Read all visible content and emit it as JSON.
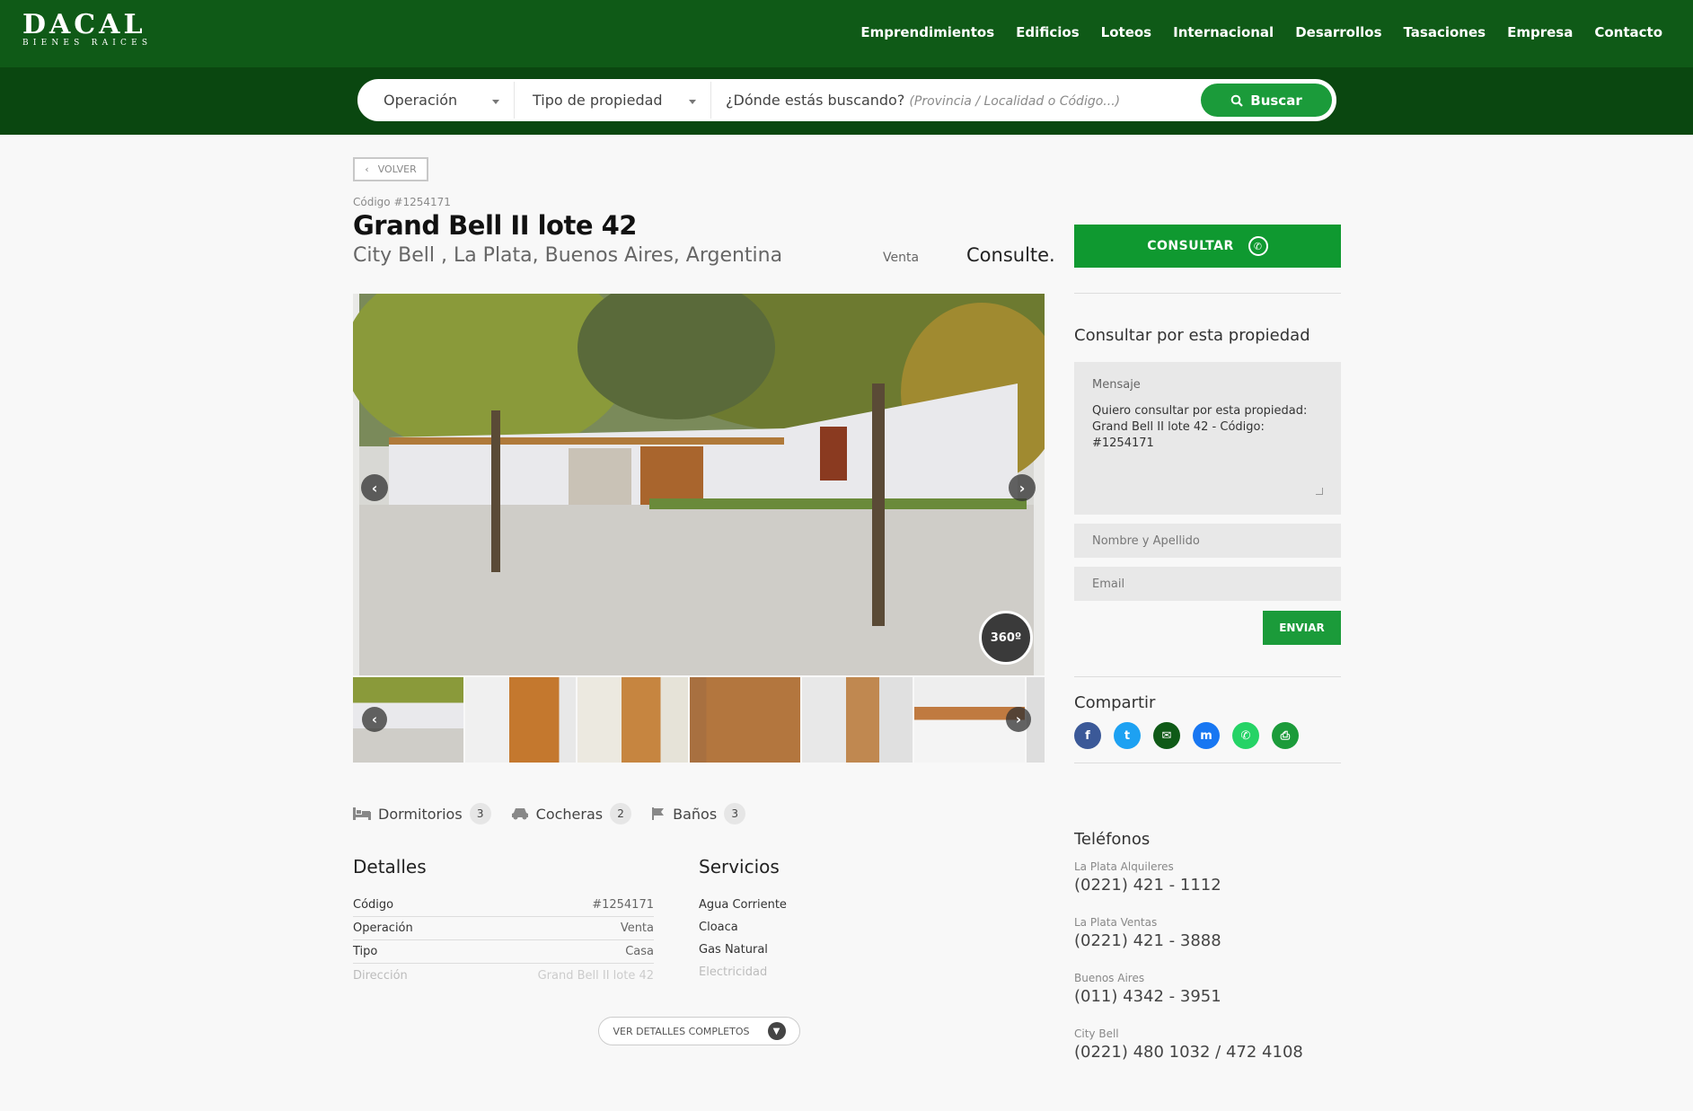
{
  "brand": {
    "name": "DACAL",
    "tagline": "BIENES RAICES"
  },
  "nav": [
    "Emprendimientos",
    "Edificios",
    "Loteos",
    "Internacional",
    "Desarrollos",
    "Tasaciones",
    "Empresa",
    "Contacto"
  ],
  "search": {
    "operation": "Operación",
    "property_type": "Tipo de propiedad",
    "where_label": "¿Dónde estás buscando?",
    "where_placeholder": "(Provincia / Localidad o Código...)",
    "button": "Buscar"
  },
  "back_label": "VOLVER",
  "property": {
    "code_label": "Código #1254171",
    "title": "Grand Bell II lote 42",
    "location": "City Bell , La Plata, Buenos Aires, Argentina",
    "operation": "Venta",
    "price": "Consulte.",
    "badge_360": "360º"
  },
  "features": [
    {
      "label": "Dormitorios",
      "count": "3",
      "icon": "bed-icon"
    },
    {
      "label": "Cocheras",
      "count": "2",
      "icon": "car-icon"
    },
    {
      "label": "Baños",
      "count": "3",
      "icon": "bath-icon"
    }
  ],
  "details": {
    "title": "Detalles",
    "rows": [
      {
        "k": "Código",
        "v": "#1254171"
      },
      {
        "k": "Operación",
        "v": "Venta"
      },
      {
        "k": "Tipo",
        "v": "Casa"
      },
      {
        "k": "Dirección",
        "v": "Grand Bell II lote 42"
      }
    ]
  },
  "services": {
    "title": "Servicios",
    "items": [
      "Agua Corriente",
      "Cloaca",
      "Gas Natural",
      "Electricidad"
    ]
  },
  "more_details": "VER DETALLES COMPLETOS",
  "sidebar": {
    "consultar": "CONSULTAR",
    "form_title": "Consultar por esta propiedad",
    "message_label": "Mensaje",
    "message_line1": "Quiero consultar por esta propiedad:",
    "message_line2": "Grand Bell II lote 42 - Código: #1254171",
    "name_placeholder": "Nombre y Apellido",
    "email_placeholder": "Email",
    "send": "ENVIAR",
    "share_title": "Compartir",
    "share_icons": [
      "facebook-icon",
      "twitter-icon",
      "email-icon",
      "messenger-icon",
      "whatsapp-icon",
      "print-icon"
    ],
    "phones_title": "Teléfonos",
    "phones": [
      {
        "city": "La Plata Alquileres",
        "num": "(0221) 421 - 1112"
      },
      {
        "city": "La Plata Ventas",
        "num": "(0221) 421 - 3888"
      },
      {
        "city": "Buenos Aires",
        "num": "(011) 4342 - 3951"
      },
      {
        "city": "City Bell",
        "num": "(0221) 480 1032 / 472 4108"
      }
    ]
  },
  "colors": {
    "header": "#0f5a17",
    "accent": "#1b9b3a"
  }
}
